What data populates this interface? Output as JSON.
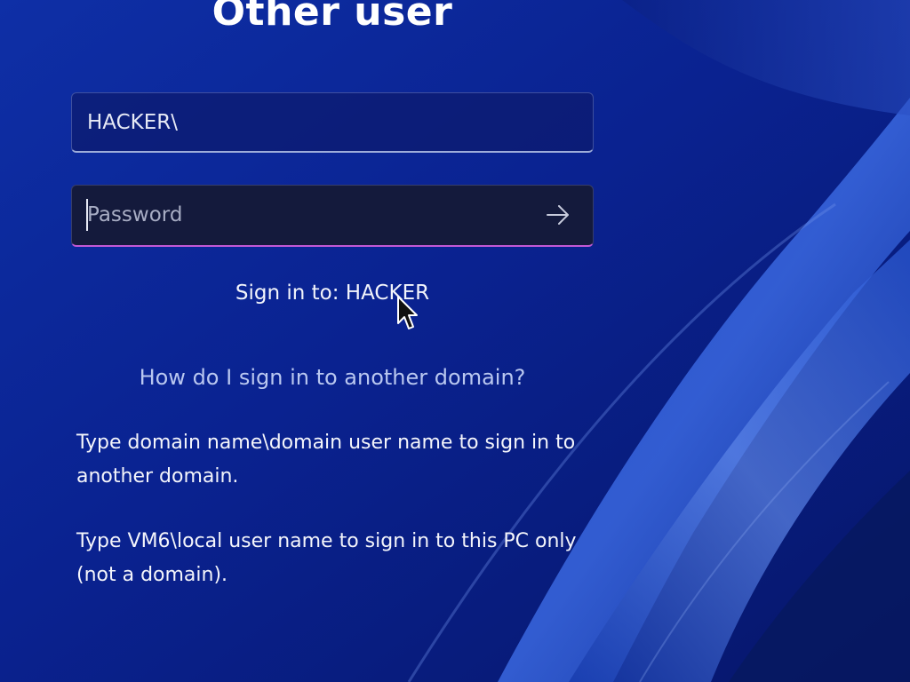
{
  "title": "Other user",
  "username_field": {
    "value": "HACKER\\"
  },
  "password_field": {
    "placeholder": "Password",
    "submit_icon": "arrow-right-icon"
  },
  "sign_in_to": "Sign in to: HACKER",
  "help_link": "How do I sign in to another domain?",
  "info": {
    "domain_instruction": "Type domain name\\domain user name to sign in to another domain.",
    "local_instruction": "Type VM6\\local user name to sign in to this PC only (not a domain)."
  },
  "colors": {
    "background": "#0b2a9c",
    "accent_underline": "#c259d6",
    "link": "#b9c7f0"
  }
}
